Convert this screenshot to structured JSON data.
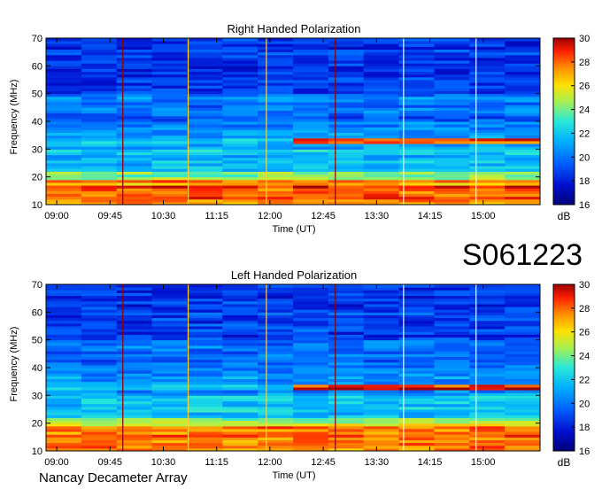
{
  "station_id": "S061223",
  "footer": "Nancay Decameter Array",
  "chart_data": [
    {
      "type": "heatmap",
      "title": "Right Handed Polarization",
      "xlabel": "Time (UT)",
      "ylabel": "Frequency (MHz)",
      "xticks": [
        "09:00",
        "09:45",
        "10:30",
        "11:15",
        "12:00",
        "12:45",
        "13:30",
        "14:15",
        "15:00"
      ],
      "xtick_hours": [
        9.0,
        9.75,
        10.5,
        11.25,
        12.0,
        12.75,
        13.5,
        14.25,
        15.0
      ],
      "xlim": [
        8.85,
        15.8
      ],
      "yticks": [
        10,
        20,
        30,
        40,
        50,
        60,
        70
      ],
      "ylim": [
        10,
        70
      ],
      "colorbar": {
        "label": "dB",
        "ticks": [
          16,
          18,
          20,
          22,
          24,
          26,
          28,
          30
        ],
        "range": [
          16,
          30
        ]
      },
      "intense_bands_mhz": [
        {
          "from": 10,
          "to": 19,
          "level_db": 28
        },
        {
          "from": 32.5,
          "to": 33.5,
          "level_db": 30
        }
      ],
      "vertical_lines_hours": [
        {
          "t": 9.93,
          "color": "#8b0000"
        },
        {
          "t": 10.85,
          "color": "#ffd23a"
        },
        {
          "t": 11.95,
          "color": "#ffd23a"
        },
        {
          "t": 12.92,
          "color": "#8b0000"
        },
        {
          "t": 13.88,
          "color": "#ffffff"
        },
        {
          "t": 14.9,
          "color": "#ffffff"
        }
      ]
    },
    {
      "type": "heatmap",
      "title": "Left Handed Polarization",
      "xlabel": "Time (UT)",
      "ylabel": "Frequency (MHz)",
      "xticks": [
        "09:00",
        "09:45",
        "10:30",
        "11:15",
        "12:00",
        "12:45",
        "13:30",
        "14:15",
        "15:00"
      ],
      "xtick_hours": [
        9.0,
        9.75,
        10.5,
        11.25,
        12.0,
        12.75,
        13.5,
        14.25,
        15.0
      ],
      "xlim": [
        8.85,
        15.8
      ],
      "yticks": [
        10,
        20,
        30,
        40,
        50,
        60,
        70
      ],
      "ylim": [
        10,
        70
      ],
      "colorbar": {
        "label": "dB",
        "ticks": [
          16,
          18,
          20,
          22,
          24,
          26,
          28,
          30
        ],
        "range": [
          16,
          30
        ]
      },
      "intense_bands_mhz": [
        {
          "from": 10,
          "to": 18.5,
          "level_db": 28
        },
        {
          "from": 32.5,
          "to": 33.5,
          "level_db": 30
        }
      ],
      "vertical_lines_hours": [
        {
          "t": 9.93,
          "color": "#8b0000"
        },
        {
          "t": 10.85,
          "color": "#ffd23a"
        },
        {
          "t": 11.95,
          "color": "#ffd23a"
        },
        {
          "t": 12.92,
          "color": "#8b0000"
        },
        {
          "t": 13.88,
          "color": "#ffffff"
        },
        {
          "t": 14.9,
          "color": "#ffffff"
        }
      ]
    }
  ]
}
